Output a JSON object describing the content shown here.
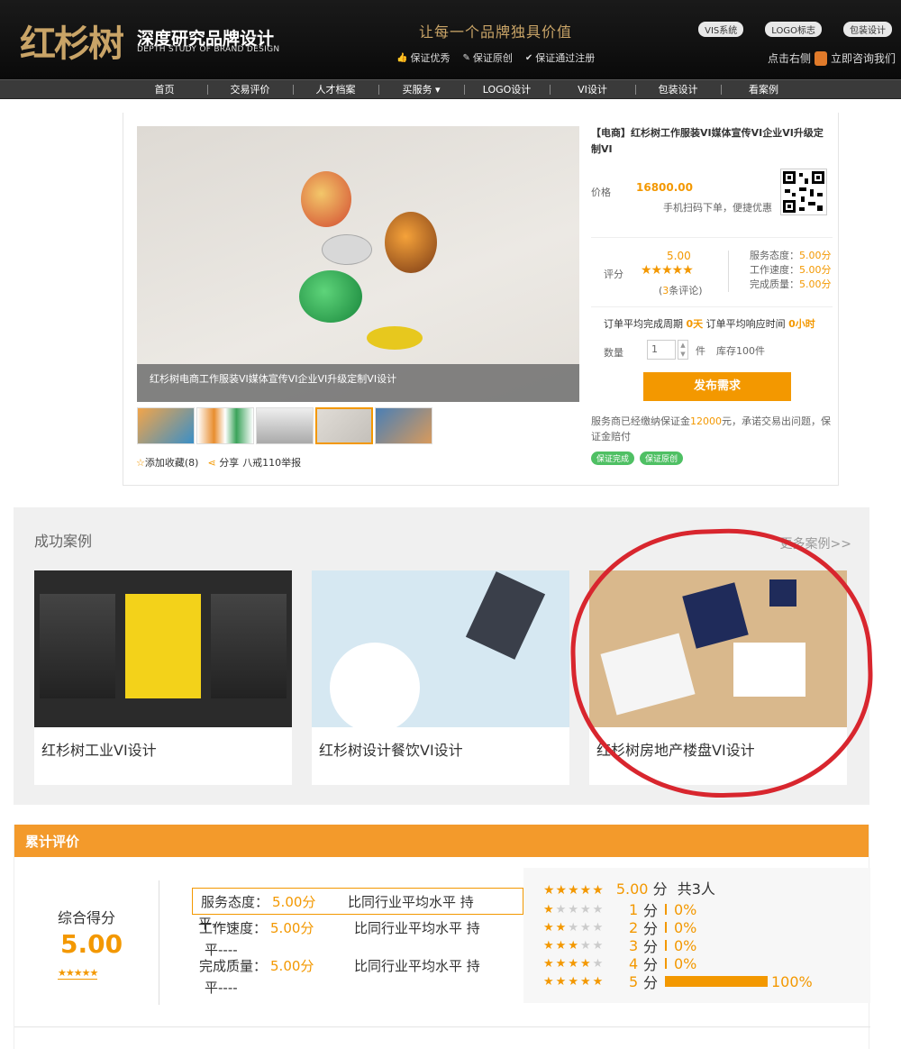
{
  "header": {
    "logo_mark": "红杉树",
    "logo_title": "深度研究品牌设计",
    "logo_sub": "DEPTH STUDY OF BRAND DESIGN",
    "slogan": "让每一个品牌独具价值",
    "guarantees": [
      "保证优秀",
      "保证原创",
      "保证通过注册"
    ],
    "tags": [
      "VIS系统",
      "LOGO标志",
      "包装设计"
    ],
    "consult_prefix": "点击右侧",
    "consult_link": "立即咨询我们"
  },
  "nav": {
    "items": [
      "首页",
      "交易评价",
      "人才档案",
      "买服务 ▾",
      "LOGO设计",
      "VI设计",
      "包装设计",
      "看案例"
    ]
  },
  "product": {
    "image_caption": "红杉树电商工作服装VI媒体宣传VI企业VI升级定制VI设计",
    "favorite": "添加收藏(8)",
    "share": "分享",
    "reporter": "八戒110举报",
    "title": "【电商】红杉树工作服装VI媒体宣传VI企业VI升级定制VI",
    "price_label": "价格",
    "price": "16800.00",
    "price_note": "手机扫码下单，便捷优惠",
    "rating_label": "评分",
    "rating_score": "5.00",
    "rating_stars": "★★★★★",
    "rating_count_num": "3",
    "rating_count_text": "条评论)",
    "details": [
      {
        "label": "服务态度：",
        "value": "5.00分"
      },
      {
        "label": "工作速度：",
        "value": "5.00分"
      },
      {
        "label": "完成质量：",
        "value": "5.00分"
      }
    ],
    "cycle_label": "订单平均完成周期",
    "cycle_value": "0天",
    "response_label": "订单平均响应时间",
    "response_value": "0小时",
    "qty_label": "数量",
    "qty_value": "1",
    "qty_unit": "件",
    "stock": "库存100件",
    "post_button": "发布需求",
    "guarantee_prefix": "服务商已经缴纳保证金",
    "guarantee_amount": "12000",
    "guarantee_suffix": "元，承诺交易出问题，保证金赔付",
    "guarantee_badges": [
      "保证完成",
      "保证原创"
    ]
  },
  "cases": {
    "title": "成功案例",
    "more": "更多案例>>",
    "items": [
      {
        "label": "红杉树工业VI设计"
      },
      {
        "label": "红杉树设计餐饮VI设计"
      },
      {
        "label": "红杉树房地产楼盘VI设计"
      }
    ]
  },
  "reviews": {
    "header": "累计评价",
    "overall_label": "综合得分",
    "overall_score": "5.00",
    "overall_stars": "★★★★★",
    "metrics": [
      {
        "label": "服务态度：",
        "value": "5.00分",
        "compare": "比同行业平均水平 持",
        "wrap": "平----"
      },
      {
        "label": "工作速度：",
        "value": "5.00分",
        "compare": "比同行业平均水平 持",
        "wrap": "平----"
      },
      {
        "label": "完成质量：",
        "value": "5.00分",
        "compare": "比同行业平均水平 持",
        "wrap": "平----"
      }
    ],
    "dist_head_stars": "★★★★★",
    "dist_head_score": "5.00",
    "dist_head_unit": "分",
    "dist_head_total": "共3人",
    "dist": [
      {
        "stars": 1,
        "num": "1",
        "unit": "分",
        "pct": "0%",
        "fraction": 0
      },
      {
        "stars": 2,
        "num": "2",
        "unit": "分",
        "pct": "0%",
        "fraction": 0
      },
      {
        "stars": 3,
        "num": "3",
        "unit": "分",
        "pct": "0%",
        "fraction": 0
      },
      {
        "stars": 4,
        "num": "4",
        "unit": "分",
        "pct": "0%",
        "fraction": 0
      },
      {
        "stars": 5,
        "num": "5",
        "unit": "分",
        "pct": "100%",
        "fraction": 1
      }
    ]
  }
}
